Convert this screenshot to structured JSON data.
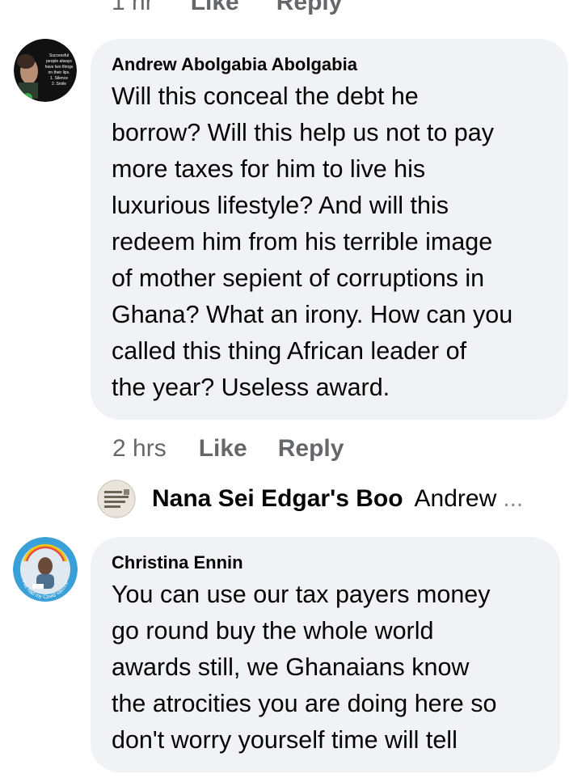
{
  "previous_comment_actions": {
    "time": "1 hr",
    "like_label": "Like",
    "reply_label": "Reply"
  },
  "comments": [
    {
      "author": "Andrew Abolgabia Abolgabia",
      "avatar_icon": "profile-photo-quote-avatar",
      "avatar_text": [
        "Successful",
        "people always",
        "have two things",
        "on their lips.",
        "1. Silence",
        "2. Smile"
      ],
      "text": "Will this conceal the debt he\nborrow?  Will this help us not to pay\nmore taxes for him to live his\nluxurious lifestyle?  And will this\nredeem him from his terrible image\nof mother sepient of corruptions in\nGhana? What an irony. How can you\ncalled this thing African leader of\nthe year? Useless award.",
      "time": "2 hrs",
      "like_label": "Like",
      "reply_label": "Reply",
      "reply_preview": {
        "name": "Nana Sei Edgar's Boo",
        "snippet": "Andrew",
        "ellipsis": "...",
        "avatar_icon": "profile-photo-text-avatar"
      }
    },
    {
      "author": "Christina Ennin",
      "avatar_icon": "profile-photo-vaccination-frame-avatar",
      "avatar_frame_text": "I've had my Covid vaccine",
      "text": "You can use our tax payers money\ngo round buy the whole world\nawards still, we Ghanaians know\nthe atrocities you are doing here so\ndon't worry yourself time will tell"
    }
  ],
  "colors": {
    "bubble_bg": "#f0f2f5",
    "text_primary": "#050505",
    "text_secondary": "#65676b",
    "frame_blue": "#3aa0d8"
  }
}
